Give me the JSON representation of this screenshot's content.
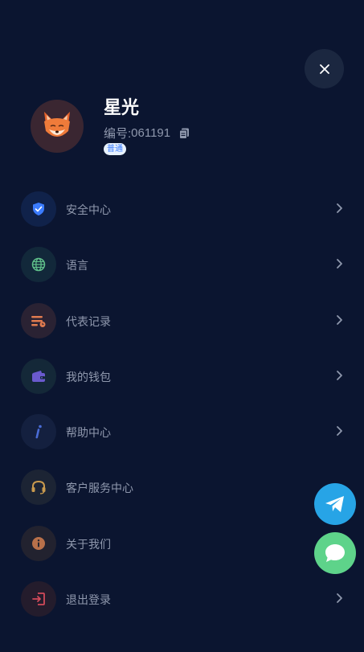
{
  "profile": {
    "name": "星光",
    "id_label": "编号:",
    "id_value": "061191",
    "badge": "普通",
    "avatar_icon": "fox-avatar-icon"
  },
  "menu": {
    "items": [
      {
        "label": "安全中心",
        "icon": "shield-icon",
        "icon_color": "#3b7cff",
        "has_chevron": true
      },
      {
        "label": "语言",
        "icon": "globe-icon",
        "icon_color": "#5fbf8a",
        "has_chevron": true
      },
      {
        "label": "代表记录",
        "icon": "records-icon",
        "icon_color": "#e07b4f",
        "has_chevron": true
      },
      {
        "label": "我的钱包",
        "icon": "wallet-icon",
        "icon_color": "#6a5acd",
        "has_chevron": true
      },
      {
        "label": "帮助中心",
        "icon": "info-italic-icon",
        "icon_color": "#4a6cd6",
        "has_chevron": true
      },
      {
        "label": "客户服务中心",
        "icon": "headset-icon",
        "icon_color": "#c99a4e",
        "has_chevron": false
      },
      {
        "label": "关于我们",
        "icon": "info-circle-icon",
        "icon_color": "#b8704a",
        "has_chevron": false
      },
      {
        "label": "退出登录",
        "icon": "logout-icon",
        "icon_color": "#d14a5a",
        "has_chevron": true
      }
    ]
  },
  "colors": {
    "background": "#0b1530",
    "telegram": "#27a4e6",
    "chat": "#5ed38a"
  }
}
